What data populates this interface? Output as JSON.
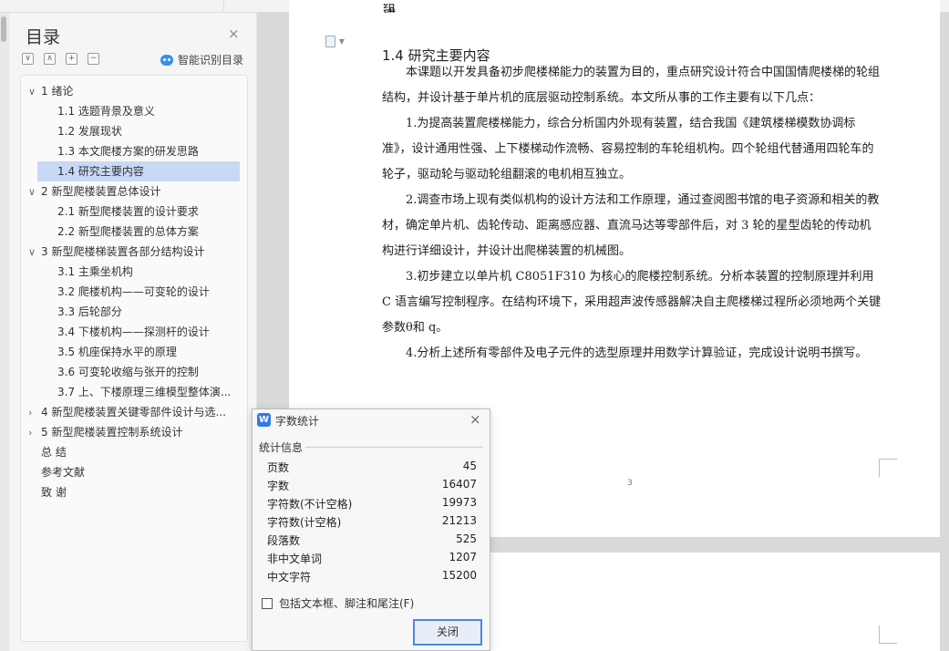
{
  "toc": {
    "title": "目录",
    "close_icon": "×",
    "tools": [
      "∨",
      "∧",
      "+",
      "−"
    ],
    "smart_toc_label": "智能识别目录",
    "items": [
      {
        "text": "1 绪论",
        "level": 1,
        "expand": "∨"
      },
      {
        "text": "1.1  选题背景及意义",
        "level": 2
      },
      {
        "text": "1.2  发展现状",
        "level": 2
      },
      {
        "text": "1.3  本文爬楼方案的研发思路",
        "level": 2
      },
      {
        "text": "1.4  研究主要内容",
        "level": 2,
        "selected": true
      },
      {
        "text": "2 新型爬楼装置总体设计",
        "level": 1,
        "expand": "∨"
      },
      {
        "text": "2.1  新型爬楼装置的设计要求",
        "level": 2
      },
      {
        "text": "2.2  新型爬楼装置的总体方案",
        "level": 2
      },
      {
        "text": "3 新型爬楼梯装置各部分结构设计",
        "level": 1,
        "expand": "∨"
      },
      {
        "text": "3.1  主乘坐机构",
        "level": 2
      },
      {
        "text": "3.2  爬楼机构——可变轮的设计",
        "level": 2
      },
      {
        "text": "3.3  后轮部分",
        "level": 2
      },
      {
        "text": "3.4 下楼机构——探测杆的设计",
        "level": 2
      },
      {
        "text": "3.5  机座保持水平的原理",
        "level": 2
      },
      {
        "text": "3.6  可变轮收缩与张开的控制",
        "level": 2
      },
      {
        "text": "3.7  上、下楼原理三维模型整体演...",
        "level": 2
      },
      {
        "text": "4 新型爬楼装置关键零部件设计与选...",
        "level": 1,
        "expand": "›"
      },
      {
        "text": "5 新型爬楼装置控制系统设计",
        "level": 1,
        "expand": "›"
      },
      {
        "text": "总    结",
        "level": 0
      },
      {
        "text": "参考文献",
        "level": 0
      },
      {
        "text": "致    谢",
        "level": 0
      }
    ]
  },
  "document": {
    "cut_text": "组成。",
    "doc_icon_caret": "▾",
    "heading": "1.4  研究主要内容",
    "paragraphs": [
      "本课题以开发具备初步爬楼梯能力的装置为目的，重点研究设计符合中国国情爬楼梯的轮组结构，并设计基于单片机的底层驱动控制系统。本文所从事的工作主要有以下几点：",
      "1.为提高装置爬楼梯能力，综合分析国内外现有装置，结合我国《建筑楼梯模数协调标准》，设计通用性强、上下楼梯动作流畅、容易控制的车轮组机构。四个轮组代替通用四轮车的轮子，驱动轮与驱动轮组翻滚的电机相互独立。",
      "2.调查市场上现有类似机构的设计方法和工作原理，通过查阅图书馆的电子资源和相关的教材，确定单片机、齿轮传动、距离感应器、直流马达等零部件后，对 3 轮的星型齿轮的传动机构进行详细设计，并设计出爬梯装置的机械图。",
      "3.初步建立以单片机 C8051F310 为核心的爬楼控制系统。分析本装置的控制原理并利用 C 语言编写控制程序。在结构环境下，采用超声波传感器解决自主爬楼梯过程所必须地两个关键参数θ和 q。",
      "4.分析上述所有零部件及电子元件的选型原理并用数学计算验证，完成设计说明书撰写。"
    ],
    "page_number": "3"
  },
  "dialog": {
    "app_icon": "W",
    "title": "字数统计",
    "close_icon": "×",
    "section": "统计信息",
    "stats": [
      {
        "label": "页数",
        "value": "45"
      },
      {
        "label": "字数",
        "value": "16407"
      },
      {
        "label": "字符数(不计空格)",
        "value": "19973"
      },
      {
        "label": "字符数(计空格)",
        "value": "21213"
      },
      {
        "label": "段落数",
        "value": "525"
      },
      {
        "label": "非中文单词",
        "value": "1207"
      },
      {
        "label": "中文字符",
        "value": "15200"
      }
    ],
    "checkbox_label": "包括文本框、脚注和尾注(F)",
    "checkbox_checked": false,
    "close_button": "关闭"
  }
}
